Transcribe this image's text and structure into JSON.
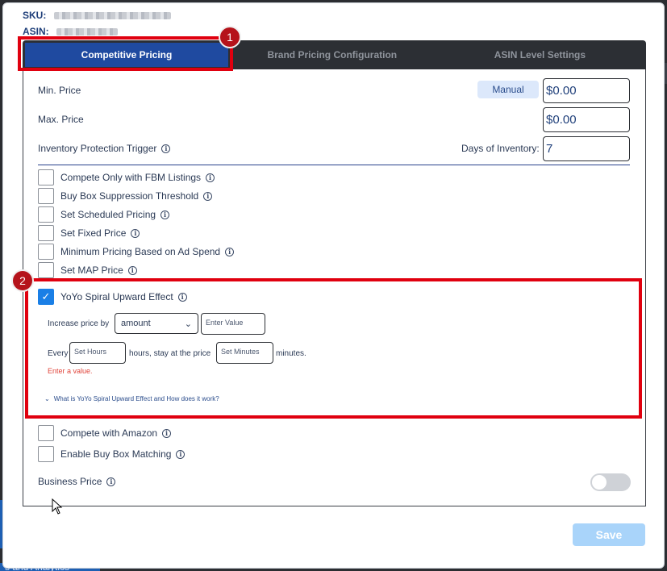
{
  "header": {
    "sku_label": "SKU:",
    "asin_label": "ASIN:"
  },
  "tabs": [
    {
      "label": "Competitive Pricing",
      "active": true
    },
    {
      "label": "Brand Pricing Configuration",
      "active": false
    },
    {
      "label": "ASIN Level Settings",
      "active": false
    }
  ],
  "pricing": {
    "min_price_label": "Min. Price",
    "manual_button": "Manual",
    "min_price_value": "$0.00",
    "max_price_label": "Max. Price",
    "max_price_value": "$0.00",
    "inventory_trigger_label": "Inventory Protection Trigger",
    "days_inventory_label": "Days of Inventory:",
    "days_inventory_value": "7"
  },
  "options": [
    {
      "label": "Compete Only with FBM Listings",
      "checked": false
    },
    {
      "label": "Buy Box Suppression Threshold",
      "checked": false
    },
    {
      "label": "Set Scheduled Pricing",
      "checked": false
    },
    {
      "label": "Set Fixed Price",
      "checked": false
    },
    {
      "label": "Minimum Pricing Based on Ad Spend",
      "checked": false
    },
    {
      "label": "Set MAP Price",
      "checked": false
    }
  ],
  "yoyo": {
    "label": "YoYo Spiral Upward Effect",
    "checked": true,
    "increase_label": "Increase price by",
    "select_value": "amount",
    "value_placeholder": "Enter Value",
    "every_label": "Every",
    "hours_placeholder": "Set Hours",
    "hours_suffix": "hours, stay at the price",
    "minutes_placeholder": "Set Minutes",
    "minutes_suffix": "minutes.",
    "error": "Enter a value.",
    "faq": "What is YoYo Spiral Upward Effect and How does it work?"
  },
  "more_options": [
    {
      "label": "Compete with Amazon",
      "checked": false
    },
    {
      "label": "Enable Buy Box Matching",
      "checked": false
    }
  ],
  "business_price": {
    "label": "Business Price",
    "enabled": false
  },
  "save_label": "Save",
  "annotations": {
    "badge_1": "1",
    "badge_2": "2",
    "highlight_color": "#e0000f"
  },
  "background": {
    "bottom_text": "s and Analytics"
  }
}
